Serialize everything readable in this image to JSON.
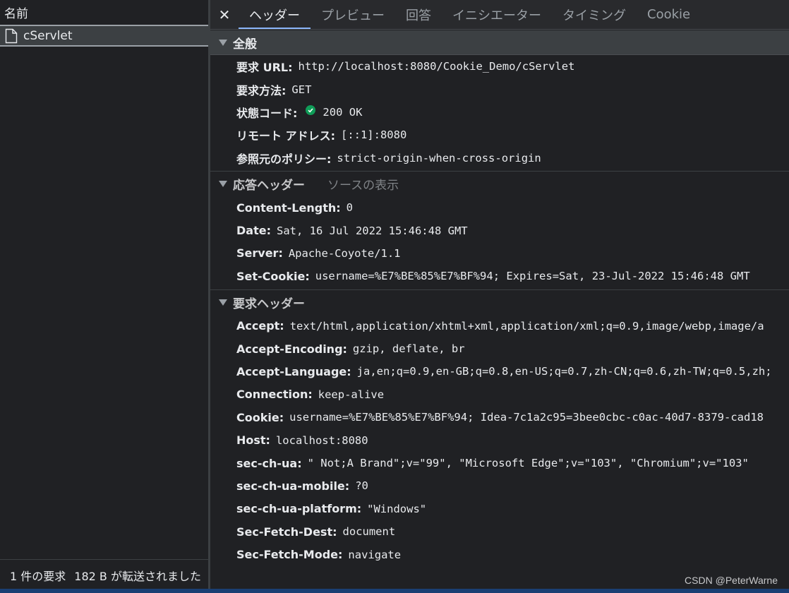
{
  "left_pane": {
    "header": "名前",
    "request_name": "cServlet",
    "footer_count": "1 件の要求",
    "footer_transfer": "182 B が転送されました"
  },
  "tabs": [
    {
      "label": "ヘッダー",
      "active": true
    },
    {
      "label": "プレビュー",
      "active": false
    },
    {
      "label": "回答",
      "active": false
    },
    {
      "label": "イニシエーター",
      "active": false
    },
    {
      "label": "タイミング",
      "active": false
    },
    {
      "label": "Cookie",
      "active": false
    }
  ],
  "close_glyph": "✕",
  "general": {
    "title": "全般",
    "rows": [
      {
        "key": "要求 URL:",
        "value": "http://localhost:8080/Cookie_Demo/cServlet"
      },
      {
        "key": "要求方法:",
        "value": "GET"
      },
      {
        "key": "状態コード:",
        "value": "200 OK"
      },
      {
        "key": "リモート アドレス:",
        "value": "[::1]:8080"
      },
      {
        "key": "参照元のポリシー:",
        "value": "strict-origin-when-cross-origin"
      }
    ]
  },
  "response_headers": {
    "title": "応答ヘッダー",
    "view_source": "ソースの表示",
    "rows": [
      {
        "key": "Content-Length:",
        "value": "0"
      },
      {
        "key": "Date:",
        "value": "Sat, 16 Jul 2022 15:46:48 GMT"
      },
      {
        "key": "Server:",
        "value": "Apache-Coyote/1.1"
      },
      {
        "key": "Set-Cookie:",
        "value": "username=%E7%BE%85%E7%BF%94; Expires=Sat, 23-Jul-2022 15:46:48 GMT"
      }
    ]
  },
  "request_headers": {
    "title": "要求ヘッダー",
    "rows": [
      {
        "key": "Accept:",
        "value": "text/html,application/xhtml+xml,application/xml;q=0.9,image/webp,image/a"
      },
      {
        "key": "Accept-Encoding:",
        "value": "gzip, deflate, br"
      },
      {
        "key": "Accept-Language:",
        "value": "ja,en;q=0.9,en-GB;q=0.8,en-US;q=0.7,zh-CN;q=0.6,zh-TW;q=0.5,zh;"
      },
      {
        "key": "Connection:",
        "value": "keep-alive"
      },
      {
        "key": "Cookie:",
        "value": "username=%E7%BE%85%E7%BF%94; Idea-7c1a2c95=3bee0cbc-c0ac-40d7-8379-cad18"
      },
      {
        "key": "Host:",
        "value": "localhost:8080"
      },
      {
        "key": "sec-ch-ua:",
        "value": "\" Not;A Brand\";v=\"99\", \"Microsoft Edge\";v=\"103\", \"Chromium\";v=\"103\""
      },
      {
        "key": "sec-ch-ua-mobile:",
        "value": "?0"
      },
      {
        "key": "sec-ch-ua-platform:",
        "value": "\"Windows\""
      },
      {
        "key": "Sec-Fetch-Dest:",
        "value": "document"
      },
      {
        "key": "Sec-Fetch-Mode:",
        "value": "navigate"
      }
    ]
  },
  "watermark": "CSDN @PeterWarne",
  "colors": {
    "background": "#202124",
    "tab_active_underline": "#8ab4f8",
    "status_ok": "#0f9d58"
  }
}
